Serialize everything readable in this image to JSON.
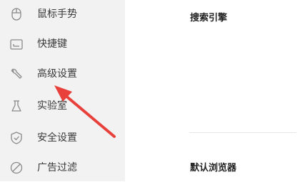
{
  "sidebar": {
    "items": [
      {
        "label": "鼠标手势",
        "icon": "mouse-icon"
      },
      {
        "label": "快捷键",
        "icon": "keyboard-icon"
      },
      {
        "label": "高级设置",
        "icon": "wrench-icon"
      },
      {
        "label": "实验室",
        "icon": "flask-icon"
      },
      {
        "label": "安全设置",
        "icon": "shield-icon"
      },
      {
        "label": "广告过滤",
        "icon": "block-icon"
      }
    ]
  },
  "main": {
    "sections": [
      {
        "title": "搜索引擎"
      },
      {
        "title": "默认浏览器"
      }
    ]
  },
  "annotation": {
    "arrow_color": "#e8413c"
  },
  "colors": {
    "sidebar_bg": "#f2f2f3",
    "text": "#3a3a3a",
    "icon": "#8a8a8a"
  }
}
